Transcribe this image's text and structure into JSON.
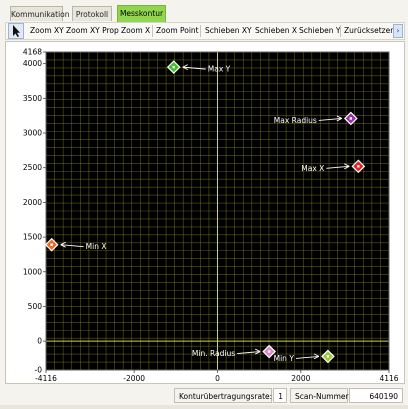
{
  "tabs": [
    {
      "label": "Kommunikation",
      "active": false
    },
    {
      "label": "Protokoll",
      "active": false
    },
    {
      "label": "Messkontur",
      "active": true
    }
  ],
  "toolbar": {
    "buttons": [
      "Zoom XY",
      "Zoom XY Prop",
      "Zoom X",
      "Zoom Point",
      "Schieben XY",
      "Schieben X",
      "Schieben Y",
      "Zurücksetzen"
    ],
    "scroll_glyph": "›"
  },
  "chart_data": {
    "type": "scatter",
    "xlim": [
      -4116,
      4116
    ],
    "ylim": [
      -416,
      4168
    ],
    "x_ticks": [
      -4116,
      -2000,
      0,
      2000,
      4116
    ],
    "y_ticks": [
      0,
      500,
      1000,
      1500,
      2000,
      2500,
      3000,
      3500,
      4000,
      4168
    ],
    "y_ticks_low": [
      -416
    ],
    "y_tick_labels": [
      "0",
      "500",
      "1000",
      "1500",
      "2000",
      "2500",
      "3000",
      "3500",
      "4000",
      "4168"
    ],
    "x_tick_labels": [
      "-4116",
      "-2000",
      "0",
      "2000",
      "4116"
    ],
    "y_low_labels": [
      "-0"
    ],
    "grid": true,
    "background": "#000000",
    "grid_color": "#7a7a1c",
    "axis_color": "#d4d44a",
    "points": [
      {
        "label": "Max Y",
        "x": -1050,
        "y": 3950,
        "color": "#3fbf2a",
        "label_side": "right"
      },
      {
        "label": "Max Radius",
        "x": 3200,
        "y": 3210,
        "color": "#9b2fb0",
        "label_side": "left"
      },
      {
        "label": "Max X",
        "x": 3380,
        "y": 2520,
        "color": "#e8231f",
        "label_side": "left"
      },
      {
        "label": "Min X",
        "x": -3980,
        "y": 1390,
        "color": "#ee6a24",
        "label_side": "right"
      },
      {
        "label": "Min. Radius",
        "x": 1240,
        "y": -150,
        "color": "#d88ac8",
        "label_side": "left"
      },
      {
        "label": "Min Y",
        "x": 2650,
        "y": -220,
        "color": "#9ac83a",
        "label_side": "left"
      }
    ]
  },
  "status": {
    "rate_label": "Konturübertragungsrate:",
    "rate_value": "1",
    "scan_label": "Scan-Nummer:",
    "scan_value": "640190"
  }
}
